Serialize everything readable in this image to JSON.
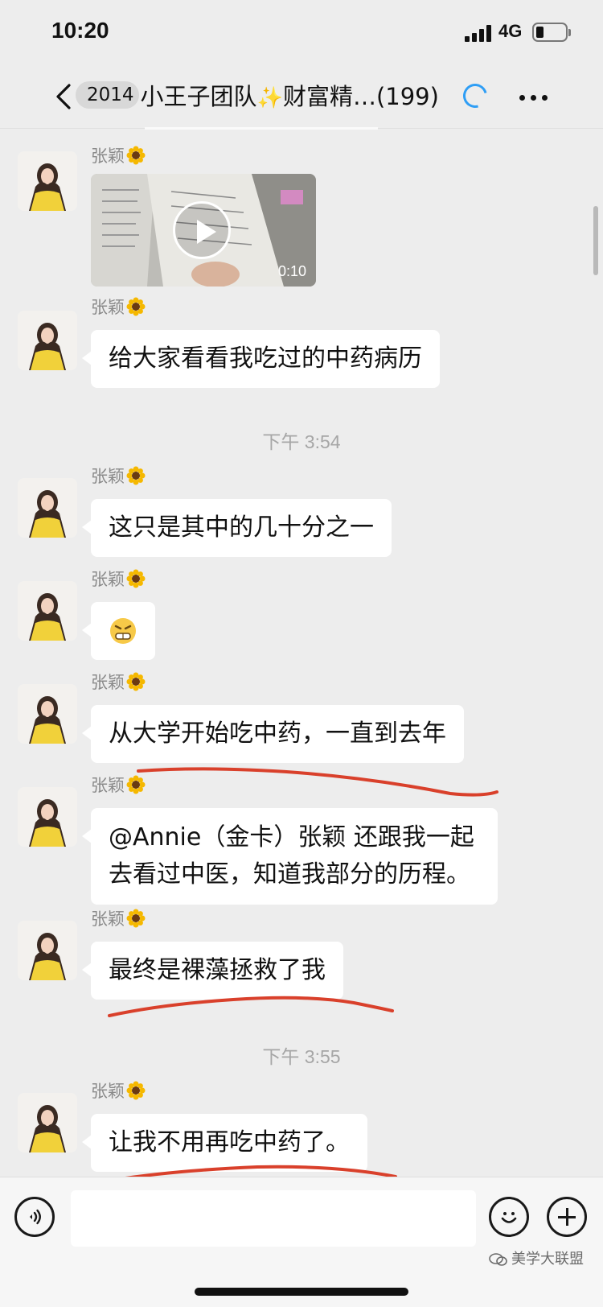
{
  "status_bar": {
    "time": "10:20",
    "network": "4G"
  },
  "nav": {
    "title_prefix": "2014",
    "title_main": "小王子团队",
    "title_spark": "✨",
    "title_tail": "财富精…(199)"
  },
  "sender_name": "张颖",
  "video": {
    "duration": "0:10"
  },
  "messages": {
    "m2": "给大家看看我吃过的中药病历",
    "m3": "这只是其中的几十分之一",
    "m5": "从大学开始吃中药，一直到去年",
    "m6": "@Annie（金卡）张颖 还跟我一起去看过中医，知道我部分的历程。",
    "m7": "最终是裸藻拯救了我",
    "m8": "让我不用再吃中药了。"
  },
  "timestamps": {
    "t1": "下午 3:54",
    "t2": "下午 3:55"
  },
  "input": {
    "placeholder": ""
  },
  "watermark": "美学大联盟",
  "colors": {
    "underline": "#d9402b",
    "loading": "#2f9ef5",
    "background": "#ededed"
  }
}
